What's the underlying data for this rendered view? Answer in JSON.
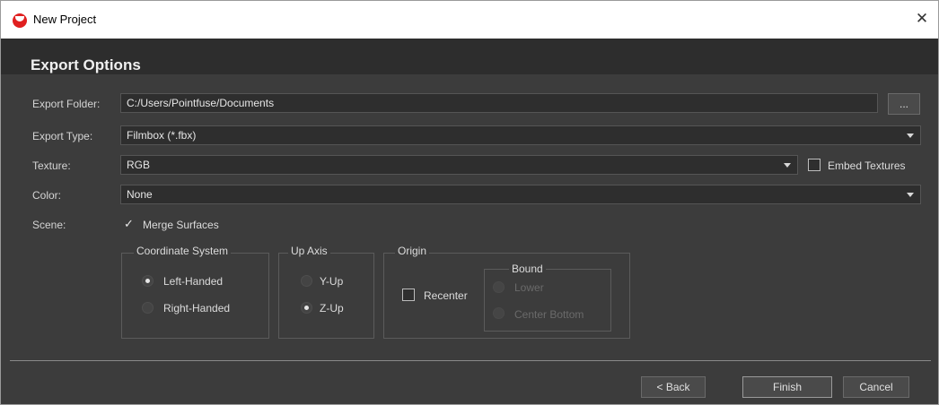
{
  "window": {
    "title": "New Project",
    "app_icon": "pointfuse-logo-icon",
    "close_glyph": "✕"
  },
  "header": {
    "title": "Export Options"
  },
  "form": {
    "export_folder": {
      "label": "Export Folder:",
      "value": "C:/Users/Pointfuse/Documents",
      "browse_label": "..."
    },
    "export_type": {
      "label": "Export Type:",
      "value": "Filmbox (*.fbx)"
    },
    "texture": {
      "label": "Texture:",
      "value": "RGB",
      "embed_label": "Embed Textures",
      "embed_checked": false
    },
    "color": {
      "label": "Color:",
      "value": "None"
    },
    "scene": {
      "label": "Scene:",
      "merge_label": "Merge Surfaces",
      "merge_checked": true,
      "check_glyph": "✓"
    }
  },
  "coordinate_system": {
    "title": "Coordinate System",
    "options": [
      "Left-Handed",
      "Right-Handed"
    ],
    "selected": "Left-Handed"
  },
  "up_axis": {
    "title": "Up Axis",
    "options": [
      "Y-Up",
      "Z-Up"
    ],
    "selected": "Z-Up"
  },
  "origin": {
    "title": "Origin",
    "recenter_label": "Recenter",
    "recenter_checked": false,
    "bound": {
      "title": "Bound",
      "options": [
        "Lower",
        "Center Bottom"
      ],
      "enabled": false
    }
  },
  "footer": {
    "back_label": "< Back",
    "finish_label": "Finish",
    "cancel_label": "Cancel"
  },
  "colors": {
    "dialog_bg": "#3c3c3c",
    "header_bg": "#2d2d2d",
    "field_bg": "#2e2e2e",
    "app_icon_red": "#e02020"
  }
}
